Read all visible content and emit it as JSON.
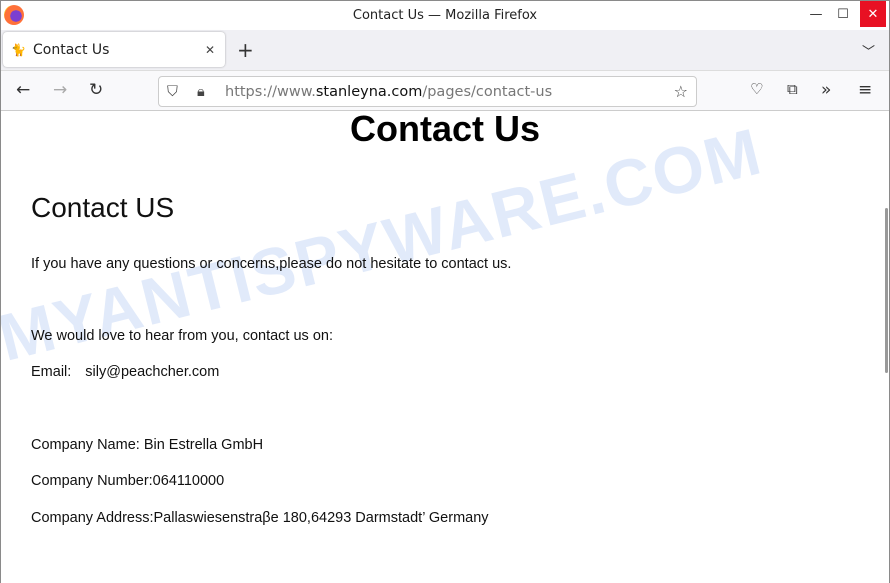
{
  "window": {
    "title": "Contact Us — Mozilla Firefox"
  },
  "tab": {
    "label": "Contact Us"
  },
  "url": {
    "prefix": "https://www.",
    "domain": "stanleyna.com",
    "path": "/pages/contact-us"
  },
  "page": {
    "heading": "Contact Us",
    "subheading": "Contact US",
    "intro": "If you have any questions or concerns,please do not hesitate to contact us.",
    "love": "We would love to hear from you, contact us on:",
    "email_label": "Email:",
    "email": "sily@peachcher.com",
    "company_name": "Company Name: Bin Estrella GmbH",
    "company_number": "Company Number:064110000",
    "company_address": "Company Address:Pallaswiesenstraβe 180,64293 Darmstadt’ Germany"
  },
  "watermark": "MYANTISPYWARE.COM"
}
